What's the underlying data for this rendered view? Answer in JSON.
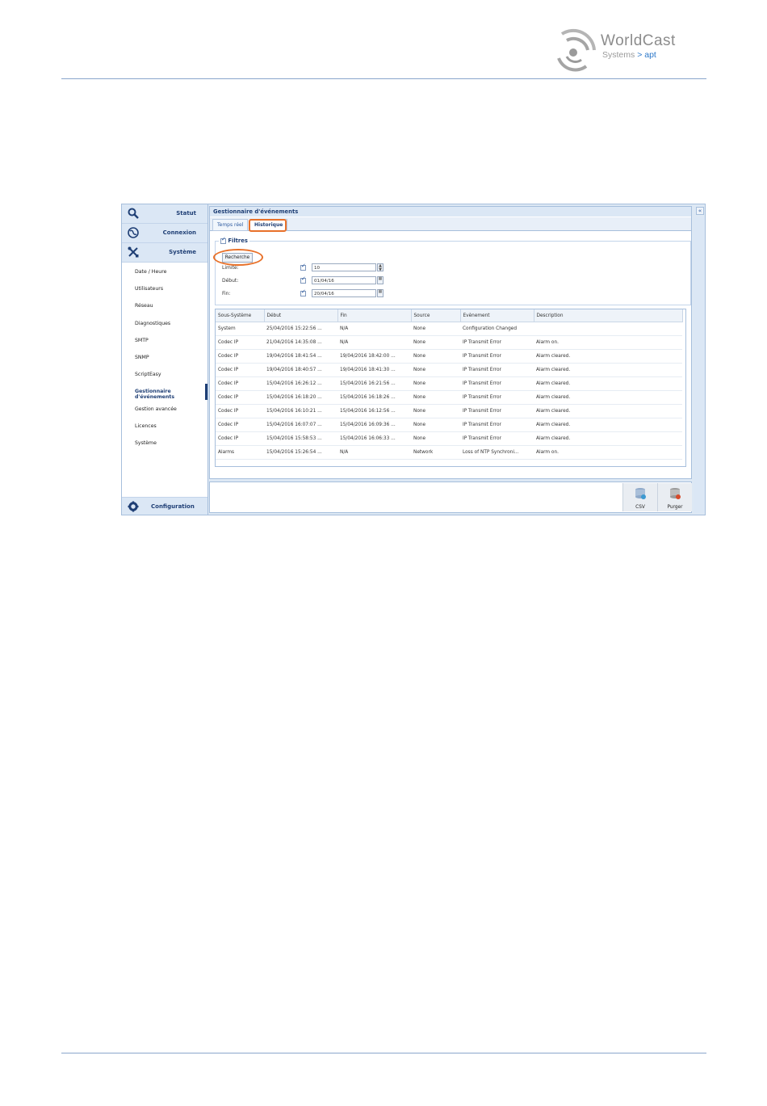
{
  "logo": {
    "brand": "WorldCast",
    "sub_systems": "Systems",
    "sub_arrow": ">",
    "sub_apt": "apt"
  },
  "sidebar": {
    "top_items": [
      {
        "label": "Statut",
        "icon": "search-icon"
      },
      {
        "label": "Connexion",
        "icon": "globe-icon"
      },
      {
        "label": "Système",
        "icon": "tools-icon"
      }
    ],
    "sub_items": [
      "Date / Heure",
      "Utilisateurs",
      "Réseau",
      "Diagnostiques",
      "SMTP",
      "SNMP",
      "ScriptEasy",
      "Gestionnaire d'événements",
      "Gestion avancée",
      "Licences",
      "Système"
    ],
    "active_index": 7,
    "bottom_item": {
      "label": "Configuration",
      "icon": "gear-icon"
    }
  },
  "main": {
    "title": "Gestionnaire d'événements",
    "tabs": [
      {
        "label": "Temps réel"
      },
      {
        "label": "Historique"
      }
    ],
    "active_tab": 1,
    "filters": {
      "legend": "Filtres",
      "search_button": "Recherche",
      "limit_label": "Limite:",
      "limit_value": "10",
      "start_label": "Début:",
      "start_value": "01/04/16",
      "end_label": "Fin:",
      "end_value": "20/04/16"
    },
    "table": {
      "columns": [
        "Sous-Système",
        "Début",
        "Fin",
        "Source",
        "Evènement",
        "Description"
      ],
      "rows": [
        [
          "System",
          "25/04/2016 15:22:56 ...",
          "N/A",
          "None",
          "Configuration Changed",
          ""
        ],
        [
          "Codec IP",
          "21/04/2016 14:35:08 ...",
          "N/A",
          "None",
          "IP Transmit Error",
          "Alarm on."
        ],
        [
          "Codec IP",
          "19/04/2016 18:41:54 ...",
          "19/04/2016 18:42:00 ...",
          "None",
          "IP Transmit Error",
          "Alarm cleared."
        ],
        [
          "Codec IP",
          "19/04/2016 18:40:57 ...",
          "19/04/2016 18:41:30 ...",
          "None",
          "IP Transmit Error",
          "Alarm cleared."
        ],
        [
          "Codec IP",
          "15/04/2016 16:26:12 ...",
          "15/04/2016 16:21:56 ...",
          "None",
          "IP Transmit Error",
          "Alarm cleared."
        ],
        [
          "Codec IP",
          "15/04/2016 16:18:20 ...",
          "15/04/2016 16:18:26 ...",
          "None",
          "IP Transmit Error",
          "Alarm cleared."
        ],
        [
          "Codec IP",
          "15/04/2016 16:10:21 ...",
          "15/04/2016 16:12:56 ...",
          "None",
          "IP Transmit Error",
          "Alarm cleared."
        ],
        [
          "Codec IP",
          "15/04/2016 16:07:07 ...",
          "15/04/2016 16:09:36 ...",
          "None",
          "IP Transmit Error",
          "Alarm cleared."
        ],
        [
          "Codec IP",
          "15/04/2016 15:58:53 ...",
          "15/04/2016 16:06:33 ...",
          "None",
          "IP Transmit Error",
          "Alarm cleared."
        ],
        [
          "Alarms",
          "15/04/2016 15:26:54 ...",
          "N/A",
          "Network",
          "Loss of NTP Synchroni...",
          "Alarm on."
        ]
      ]
    },
    "toolbar": {
      "csv_label": "CSV",
      "purge_label": "Purger"
    }
  },
  "colors": {
    "accent": "#1f3f75",
    "highlight": "#e8712a",
    "panel": "#dbe7f5"
  }
}
